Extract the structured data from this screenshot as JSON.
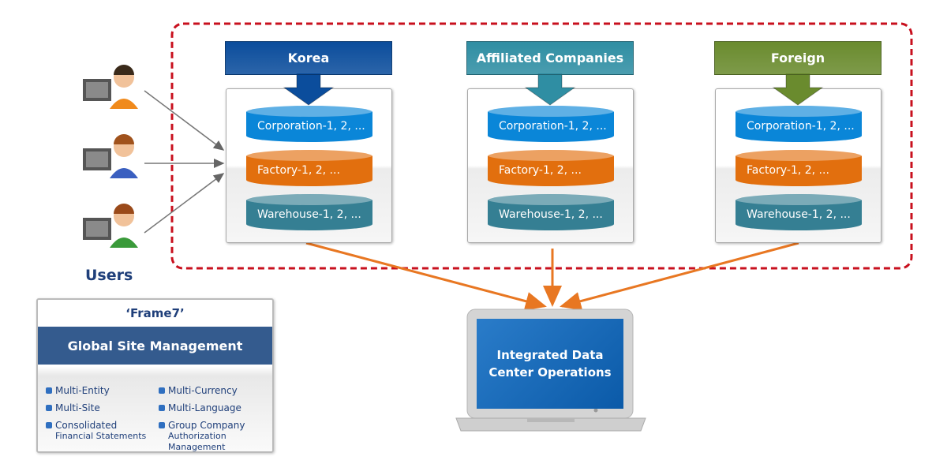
{
  "colors": {
    "korea": "#0b4d9c",
    "affiliated": "#2f8ea3",
    "foreign": "#6a8b2e",
    "corporation": "#0a86d8",
    "factory": "#e26f0e",
    "warehouse": "#357f93",
    "dashed_border": "#c8101e",
    "arrow_orange": "#e87722"
  },
  "regions": [
    {
      "label": "Korea",
      "items": [
        "Corporation-1, 2, ...",
        "Factory-1, 2, ...",
        "Warehouse-1, 2, ..."
      ]
    },
    {
      "label": "Affiliated Companies",
      "items": [
        "Corporation-1, 2, ...",
        "Factory-1, 2, ...",
        "Warehouse-1, 2, ..."
      ]
    },
    {
      "label": "Foreign",
      "items": [
        "Corporation-1, 2, ...",
        "Factory-1, 2, ...",
        "Warehouse-1, 2, ..."
      ]
    }
  ],
  "users_label": "Users",
  "frame": {
    "title": "‘Frame7’",
    "band": "Global Site Management",
    "features": [
      [
        "Multi-Entity",
        ""
      ],
      [
        "Multi-Currency",
        ""
      ],
      [
        "Multi-Site",
        ""
      ],
      [
        "Multi-Language",
        ""
      ],
      [
        "Consolidated",
        "Financial Statements"
      ],
      [
        "Group Company",
        "Authorization Management"
      ]
    ]
  },
  "data_center": "Integrated Data Center Operations"
}
